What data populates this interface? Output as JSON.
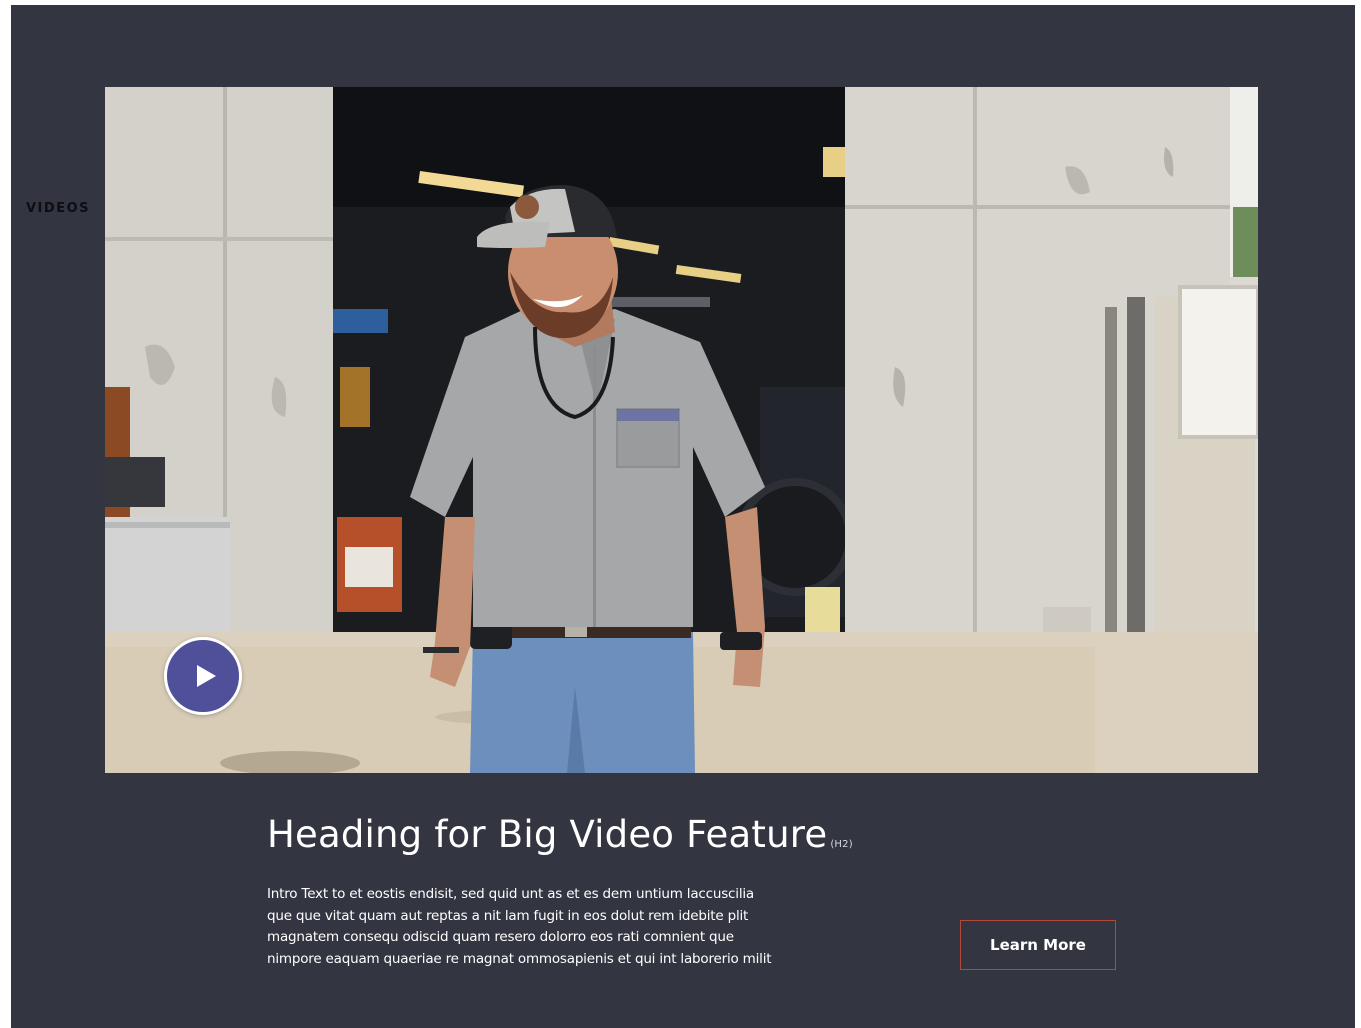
{
  "section": {
    "label": "VIDEOS",
    "background_color": "#333541"
  },
  "video": {
    "thumbnail_icon": "video-thumbnail-image",
    "play_icon": "play-icon",
    "play_button_color": "#4f4f9a"
  },
  "feature": {
    "heading": "Heading for Big Video Feature",
    "heading_tag": "(H2)",
    "intro_lines": [
      "Intro Text to et eostis endisit, sed quid unt as et es dem untium laccuscilia",
      "que que vitat quam aut reptas a nit lam fugit in eos dolut rem idebite plit",
      "magnatem consequ odiscid quam resero dolorro eos rati comnient que",
      "nimpore eaquam quaeriae re magnat ommosapienis et qui int laborerio milit"
    ],
    "button_label": "Learn More",
    "button_border_color": "#b2473a"
  }
}
